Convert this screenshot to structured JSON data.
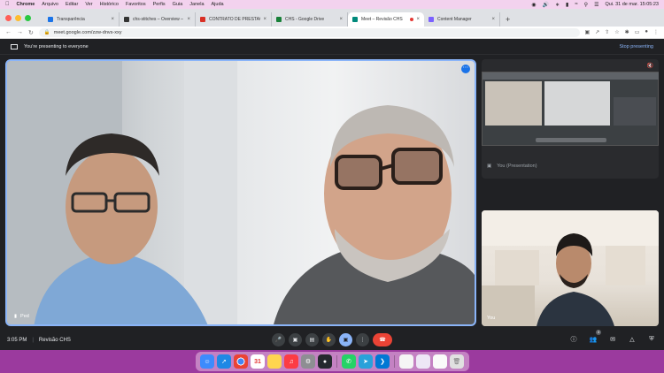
{
  "menubar": {
    "app": "Chrome",
    "items": [
      "Arquivo",
      "Editar",
      "Ver",
      "Histórico",
      "Favoritos",
      "Perfis",
      "Guia",
      "Janela",
      "Ajuda"
    ],
    "datetime": "Qui. 31 de mar. 15:05:23"
  },
  "tabs": [
    {
      "title": "Transparência",
      "favicon_color": "#1a73e8",
      "active": false
    },
    {
      "title": "chs-stitches – Overview – Ver...",
      "favicon_color": "#333333",
      "active": false
    },
    {
      "title": "CONTRATO DE PRESTAÇÃO D...",
      "favicon_color": "#d93025",
      "active": false
    },
    {
      "title": "CHS - Google Drive",
      "favicon_color": "#188038",
      "active": false
    },
    {
      "title": "Meet – Revisão CHS",
      "favicon_color": "#00897b",
      "active": true,
      "recording": true
    },
    {
      "title": "Content Manager",
      "favicon_color": "#7b61ff",
      "active": false
    }
  ],
  "address": {
    "url": "meet.google.com/zzw-dnvs-xxy"
  },
  "meet": {
    "banner_text": "You're presenting to everyone",
    "stop_label": "Stop presenting",
    "main_tile_name": "Ped",
    "side_presenting_label": "You (Presentation)",
    "self_tile_name": "You",
    "time": "3:05 PM",
    "meeting_title": "Revisão CHS",
    "participant_count": "3"
  },
  "colors": {
    "accent": "#8ab4f8",
    "end_call": "#ea4335",
    "meet_bg": "#202124"
  },
  "dock": {
    "apps": [
      {
        "name": "finder",
        "color": "#3d8bfd"
      },
      {
        "name": "safari",
        "color": "#1e88e5"
      },
      {
        "name": "chrome",
        "color": "#ffffff"
      },
      {
        "name": "calendar",
        "color": "#ffffff",
        "label": "31"
      },
      {
        "name": "notes",
        "color": "#ffd54f"
      },
      {
        "name": "music",
        "color": "#fc3c44"
      },
      {
        "name": "settings",
        "color": "#8e8e93"
      },
      {
        "name": "github",
        "color": "#24292e"
      },
      {
        "name": "whatsapp",
        "color": "#25d366"
      },
      {
        "name": "telegram",
        "color": "#2aa1da"
      },
      {
        "name": "vscode",
        "color": "#0078d4"
      },
      {
        "name": "document",
        "color": "#f5f5f5"
      },
      {
        "name": "window",
        "color": "#ede7f6"
      },
      {
        "name": "screenshot",
        "color": "#fafafa"
      },
      {
        "name": "trash",
        "color": "#e0e0e0"
      }
    ]
  }
}
